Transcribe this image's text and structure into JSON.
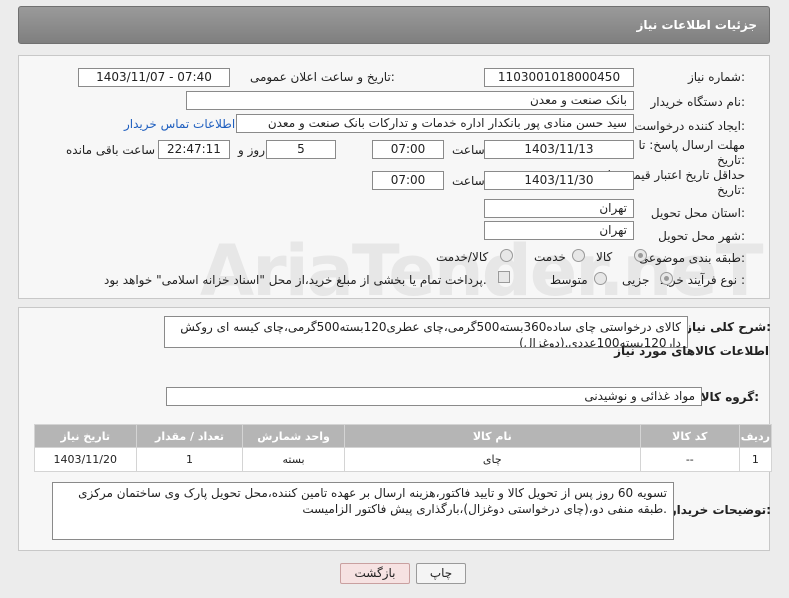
{
  "header": {
    "title": "جزئیات اطلاعات نیاز"
  },
  "fields": {
    "need_number_label": "شماره نیاز:",
    "need_number": "1103001018000450",
    "announce_label": "تاریخ و ساعت اعلان عمومی:",
    "announce_value": "1403/11/07 - 07:40",
    "buyer_org_label": "نام دستگاه خریدار:",
    "buyer_org": "بانک صنعت و معدن",
    "creator_label": "ایجاد کننده درخواست:",
    "creator": "سید حسن منادی پور بانکدار اداره خدمات و تدارکات بانک صنعت و معدن",
    "contact_link": "اطلاعات تماس خریدار",
    "deadline_label_1": "مهلت ارسال پاسخ: تا",
    "deadline_label_2": "تاریخ:",
    "deadline_date": "1403/11/13",
    "time_label": "ساعت",
    "deadline_time": "07:00",
    "days_value": "5",
    "days_label": "روز و",
    "remaining_time": "22:47:11",
    "remaining_label": "ساعت باقی مانده",
    "validity_label_1": "حداقل تاریخ اعتبار قیمت: تا",
    "validity_label_2": "تاریخ:",
    "validity_date": "1403/11/30",
    "validity_time": "07:00",
    "province_label": "استان محل تحویل:",
    "province": "تهران",
    "city_label": "شهر محل تحویل:",
    "city": "تهران",
    "category_label": "طبقه بندی موضوعی:",
    "category_options": [
      "کالا",
      "خدمت",
      "کالا/خدمت"
    ],
    "purchase_type_label": "نوع فرآیند خرید :",
    "purchase_options": [
      "جزیی",
      "متوسط"
    ],
    "payment_note": "پرداخت تمام یا بخشی از مبلغ خرید،از محل \"اسناد خزانه اسلامی\" خواهد بود."
  },
  "description": {
    "label": "شرح کلی نیاز:",
    "text": "کالای درخواستی چای ساده360بسته500گرمی،چای عطری120بسته500گرمی،چای کیسه ای روکش دار120بسته100عددی.(دوغزال)"
  },
  "goods": {
    "section_title": "اطلاعات کالاهای مورد نیاز",
    "group_label": "گروه کالا:",
    "group_value": "مواد غذائی و نوشیدنی",
    "columns": [
      "ردیف",
      "کد کالا",
      "نام کالا",
      "واحد شمارش",
      "تعداد / مقدار",
      "تاریخ نیاز"
    ],
    "rows": [
      {
        "row": "1",
        "code": "--",
        "name": "چای",
        "unit": "بسته",
        "qty": "1",
        "date": "1403/11/20"
      }
    ]
  },
  "notes": {
    "label": "توضیحات خریدار:",
    "text": "تسویه 60 روز پس از تحویل کالا و تایید فاکتور،هزینه ارسال بر عهده تامین کننده،محل تحویل پارک وی ساختمان مرکزی طبقه منفی دو،(چای درخواستی دوغزال)،بارگذاری پیش فاکتور الزامیست."
  },
  "buttons": {
    "print": "چاپ",
    "back": "بازگشت"
  },
  "watermark": "AriaTender.neT",
  "colors": {
    "header": "#8a8a8a",
    "link": "#1f5fbf",
    "back_button": "#f6e2e2"
  }
}
